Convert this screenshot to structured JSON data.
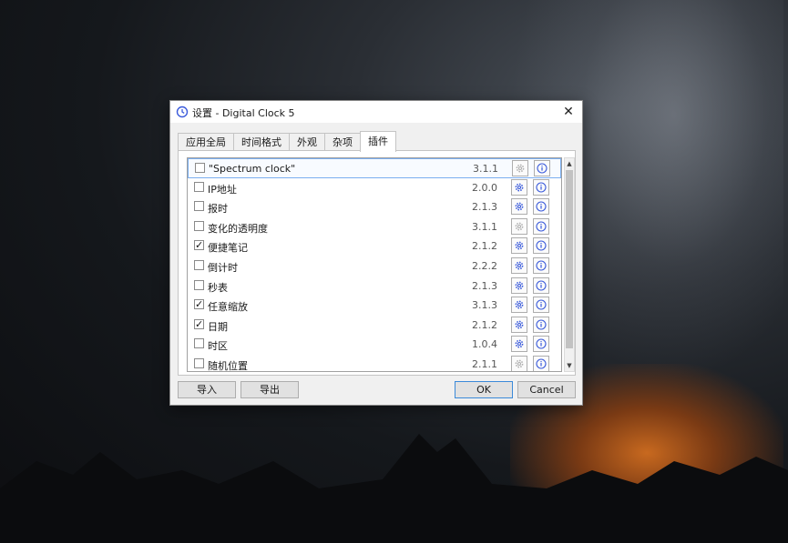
{
  "window": {
    "title": "设置 - Digital Clock 5",
    "close_glyph": "✕"
  },
  "tabs": [
    {
      "label": "应用全局",
      "active": false
    },
    {
      "label": "时间格式",
      "active": false
    },
    {
      "label": "外观",
      "active": false
    },
    {
      "label": "杂项",
      "active": false
    },
    {
      "label": "插件",
      "active": true
    }
  ],
  "plugins": [
    {
      "name": "\"Spectrum clock\"",
      "version": "3.1.1",
      "checked": false,
      "configurable": false
    },
    {
      "name": "IP地址",
      "version": "2.0.0",
      "checked": false,
      "configurable": true
    },
    {
      "name": "报时",
      "version": "2.1.3",
      "checked": false,
      "configurable": true
    },
    {
      "name": "变化的透明度",
      "version": "3.1.1",
      "checked": false,
      "configurable": false
    },
    {
      "name": "便捷笔记",
      "version": "2.1.2",
      "checked": true,
      "configurable": true
    },
    {
      "name": "倒计时",
      "version": "2.2.2",
      "checked": false,
      "configurable": true
    },
    {
      "name": "秒表",
      "version": "2.1.3",
      "checked": false,
      "configurable": true
    },
    {
      "name": "任意缩放",
      "version": "3.1.3",
      "checked": true,
      "configurable": true
    },
    {
      "name": "日期",
      "version": "2.1.2",
      "checked": true,
      "configurable": true
    },
    {
      "name": "时区",
      "version": "1.0.4",
      "checked": false,
      "configurable": true
    },
    {
      "name": "随机位置",
      "version": "2.1.1",
      "checked": false,
      "configurable": false
    }
  ],
  "buttons": {
    "import": "导入",
    "export": "导出",
    "ok": "OK",
    "cancel": "Cancel"
  },
  "icons": {
    "title": "clock-icon",
    "settings": "gear-icon",
    "about": "info-icon"
  },
  "colors": {
    "accent": "#3b8ad9",
    "icon_active": "#3b5bdb",
    "icon_disabled": "#b0b0b0"
  }
}
